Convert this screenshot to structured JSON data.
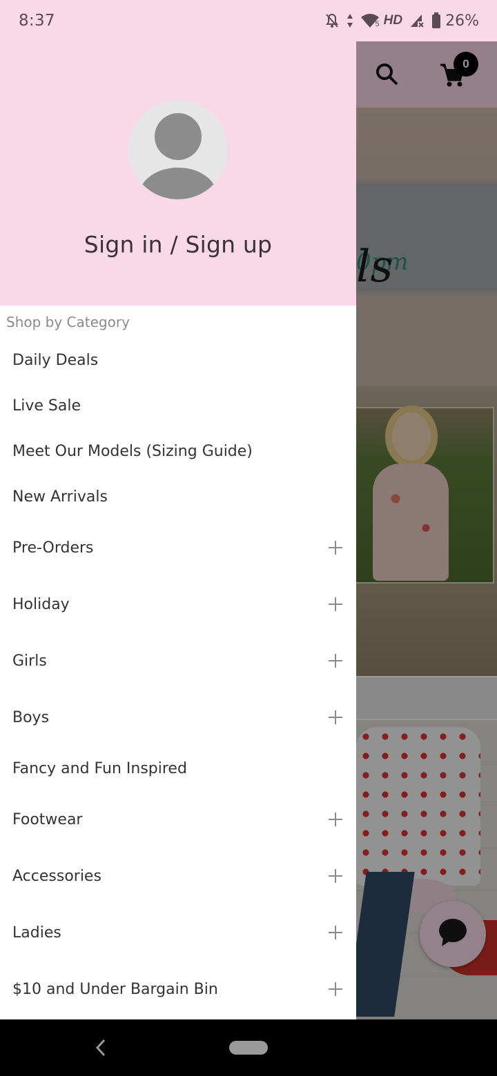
{
  "status_bar": {
    "time": "8:37",
    "icons": [
      "notifications-off-icon",
      "data-arrows-icon",
      "wifi-icon",
      "signal-no-sim-icon",
      "battery-icon"
    ],
    "wifi_badge": "5",
    "network_label": "HD",
    "battery_percent": "26%"
  },
  "background_app": {
    "toolbar": {
      "search_icon": "search-icon",
      "cart_icon": "cart-icon",
      "cart_count": "0"
    },
    "banner_1_partial_text": "0pm",
    "banner_2_partial_text": "ls",
    "chat_button_icon": "chat-bubble-icon"
  },
  "drawer": {
    "header": {
      "avatar_icon": "person-placeholder-icon",
      "sign_in_label": "Sign in / Sign up"
    },
    "section_title": "Shop by Category",
    "categories": [
      {
        "label": "Daily Deals",
        "expandable": false
      },
      {
        "label": "Live Sale",
        "expandable": false
      },
      {
        "label": "Meet Our Models (Sizing Guide)",
        "expandable": false
      },
      {
        "label": "New Arrivals",
        "expandable": false
      },
      {
        "label": "Pre-Orders",
        "expandable": true
      },
      {
        "label": "Holiday",
        "expandable": true
      },
      {
        "label": "Girls",
        "expandable": true
      },
      {
        "label": "Boys",
        "expandable": true
      },
      {
        "label": "Fancy and Fun Inspired",
        "expandable": false
      },
      {
        "label": "Footwear",
        "expandable": true
      },
      {
        "label": "Accessories",
        "expandable": true
      },
      {
        "label": "Ladies",
        "expandable": true
      },
      {
        "label": "$10 and Under Bargain Bin",
        "expandable": true
      }
    ]
  },
  "nav_bar": {
    "back_icon": "back-chevron-icon",
    "home_icon": "home-pill-icon"
  }
}
